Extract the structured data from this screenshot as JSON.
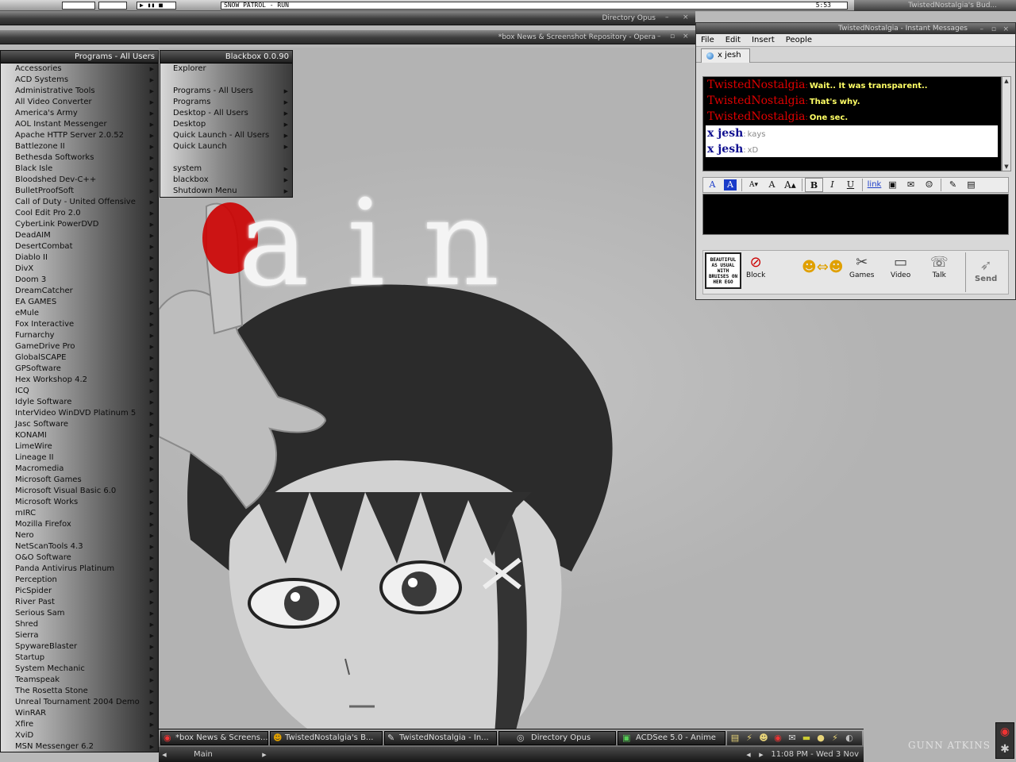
{
  "top_bar": {
    "window_title": "SNOW PATROL - RUN",
    "clock": "5:53",
    "buddy_title": "TwistedNostalgia's Bud..."
  },
  "windows": {
    "directory_opus": "Directory Opus",
    "opera": "*box News & Screenshot Repository - Opera"
  },
  "programs_menu": {
    "title": "Programs - All Users",
    "items": [
      "Accessories",
      "ACD Systems",
      "Administrative Tools",
      "All Video Converter",
      "America's Army",
      "AOL Instant Messenger",
      "Apache HTTP Server 2.0.52",
      "Battlezone II",
      "Bethesda Softworks",
      "Black Isle",
      "Bloodshed Dev-C++",
      "BulletProofSoft",
      "Call of Duty - United Offensive",
      "Cool Edit Pro 2.0",
      "CyberLink PowerDVD",
      "DeadAIM",
      "DesertCombat",
      "Diablo II",
      "DivX",
      "Doom 3",
      "DreamCatcher",
      "EA GAMES",
      "eMule",
      "Fox Interactive",
      "Furnarchy",
      "GameDrive Pro",
      "GlobalSCAPE",
      "GPSoftware",
      "Hex Workshop 4.2",
      "ICQ",
      "Idyle Software",
      "InterVideo WinDVD Platinum 5",
      "Jasc Software",
      "KONAMI",
      "LimeWire",
      "Lineage II",
      "Macromedia",
      "Microsoft Games",
      "Microsoft Visual Basic 6.0",
      "Microsoft Works",
      "mIRC",
      "Mozilla Firefox",
      "Nero",
      "NetScanTools 4.3",
      "O&O Software",
      "Panda Antivirus Platinum",
      "Perception",
      "PicSpider",
      "River Past",
      "Serious Sam",
      "Shred",
      "Sierra",
      "SpywareBlaster",
      "Startup",
      "System Mechanic",
      "Teamspeak",
      "The Rosetta Stone",
      "Unreal Tournament 2004 Demo",
      "WinRAR",
      "Xfire",
      "XviD",
      "MSN Messenger 6.2"
    ]
  },
  "root_menu": {
    "title": "Blackbox 0.0.90",
    "group1": [
      "Explorer"
    ],
    "group2": [
      "Programs - All Users",
      "Programs",
      "Desktop - All Users",
      "Desktop",
      "Quick Launch - All Users",
      "Quick Launch"
    ],
    "group3": [
      "system",
      "blackbox",
      "Shutdown Menu"
    ]
  },
  "im": {
    "title": "TwistedNostalgia - Instant Messages",
    "menu": [
      "File",
      "Edit",
      "Insert",
      "People"
    ],
    "tab": "x jesh",
    "messages": [
      {
        "name": "TwistedNostalgia",
        "text": "Wait.. It was transparent.."
      },
      {
        "name": "TwistedNostalgia",
        "text": "That's why."
      },
      {
        "name": "TwistedNostalgia",
        "text": "One sec."
      },
      {
        "name": "x jesh",
        "text": "kays"
      },
      {
        "name": "x jesh",
        "text": "xD"
      }
    ],
    "buddy_icon_text": "BEAUTIFUL AS USUAL WITH BRUISES ON HER EGO",
    "actions": {
      "block": "Block",
      "games": "Games",
      "video": "Video",
      "talk": "Talk",
      "send": "Send"
    }
  },
  "wallpaper": {
    "word": "lain"
  },
  "taskbar": {
    "tasks": [
      "*box News & Screens...",
      "TwistedNostalgia's B...",
      "TwistedNostalgia - In...",
      "Directory Opus",
      "ACDSee 5.0 - Anime"
    ],
    "workspace": "Main",
    "datetime": "11:08 PM - Wed 3 Nov"
  },
  "watermark": "GUNN ATKINS"
}
